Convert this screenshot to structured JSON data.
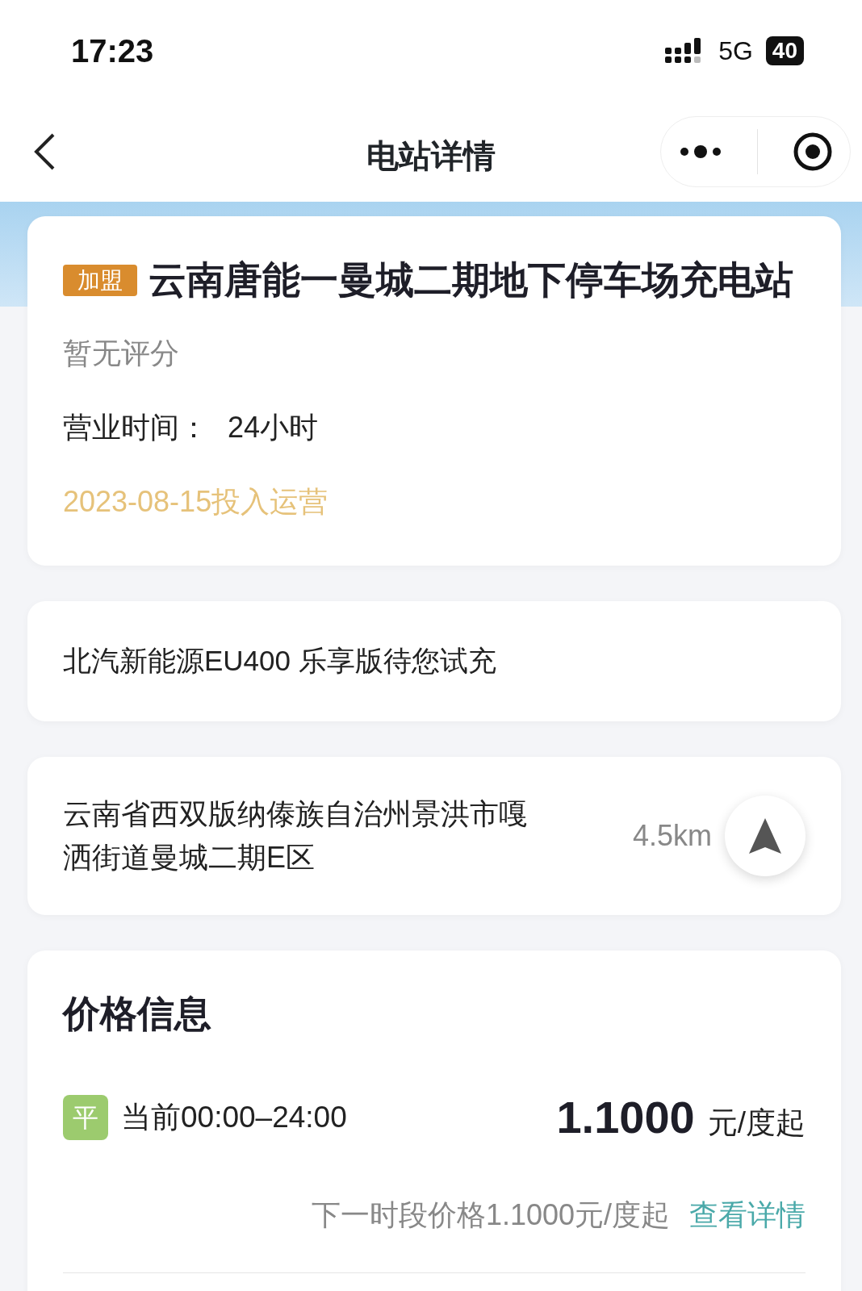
{
  "status_bar": {
    "time": "17:23",
    "network": "5G",
    "battery": "40"
  },
  "nav": {
    "title": "电站详情"
  },
  "station": {
    "badge": "加盟",
    "name": "云南唐能一曼城二期地下停车场充电站",
    "rating": "暂无评分",
    "hours_label": "营业时间：",
    "hours": "24小时",
    "opened": "2023-08-15投入运营"
  },
  "promo": {
    "text": "北汽新能源EU400 乐享版待您试充"
  },
  "address": {
    "text": "云南省西双版纳傣族自治州景洪市嘎洒街道曼城二期E区",
    "distance": "4.5km"
  },
  "price": {
    "title": "价格信息",
    "period_tag": "平",
    "period": "当前00:00–24:00",
    "amount": "1.1000",
    "unit": "元/度起",
    "next": "下一时段价格1.1000元/度起",
    "details_link": "查看详情"
  }
}
